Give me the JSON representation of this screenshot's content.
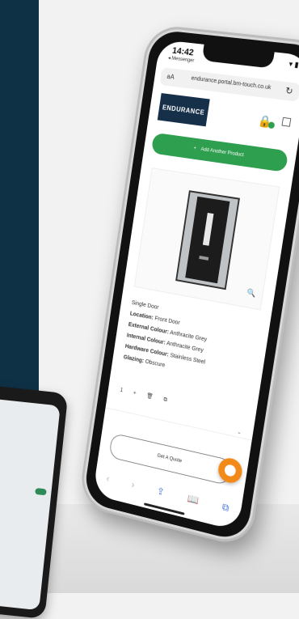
{
  "status": {
    "time": "14:42",
    "back_label": "◂ Messenger",
    "icons": "▾ ▮"
  },
  "browser": {
    "aa": "aA",
    "url": "endurance.portal.bm-touch.co.uk",
    "reload": "↻"
  },
  "header": {
    "logo_text": "ENDURANCE",
    "basket_icon": "🔒",
    "menu_icon": "☐"
  },
  "add_button": {
    "icon": "+",
    "label": "Add Another Product"
  },
  "product": {
    "zoom_icon": "🔍",
    "specs": [
      {
        "label": "",
        "value": "Single Door"
      },
      {
        "label": "Location:",
        "value": "Front Door"
      },
      {
        "label": "External Colour:",
        "value": "Anthracite Grey"
      },
      {
        "label": "Internal Colour:",
        "value": "Anthracite Grey"
      },
      {
        "label": "Hardware Colour:",
        "value": "Stainless Steel"
      },
      {
        "label": "Glazing:",
        "value": "Obscure"
      }
    ],
    "quantity": "1 + 🗑 ⧉"
  },
  "quote_button": {
    "label": "Get A Quote"
  },
  "toolbar": {
    "back": "‹",
    "forward": "›",
    "share": "⇪",
    "bookmarks": "📖",
    "tabs": "⧉"
  },
  "colors": {
    "accent_green": "#2e9e4f",
    "chat_orange": "#f28a1a",
    "brand_navy": "#163049"
  }
}
